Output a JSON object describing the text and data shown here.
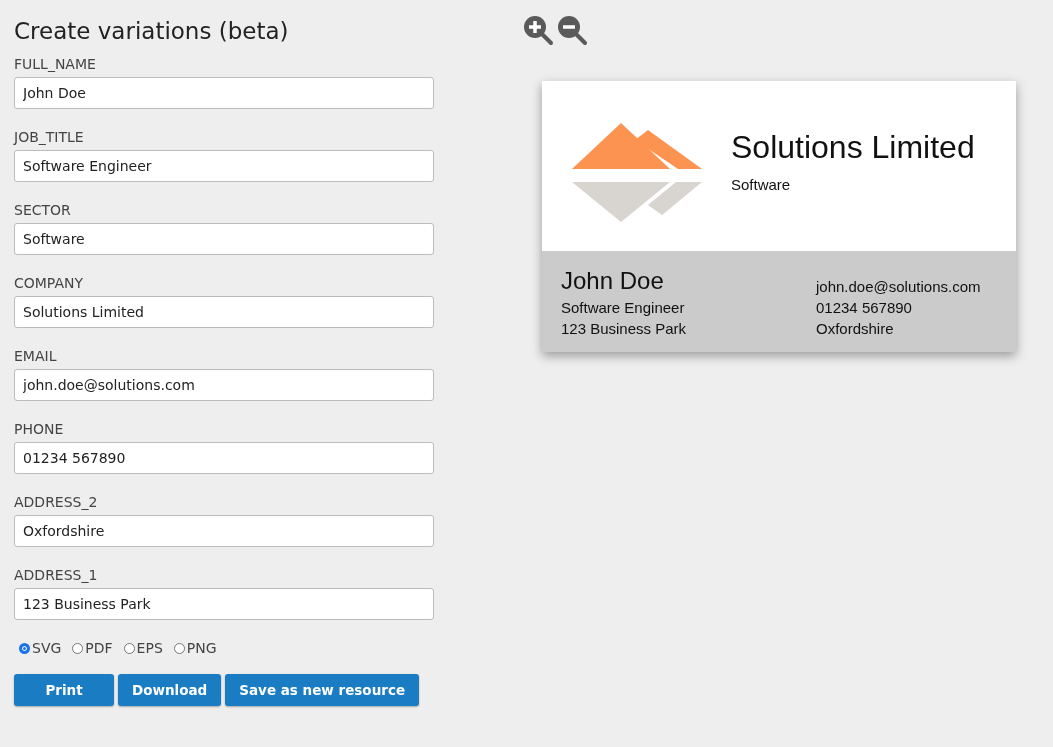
{
  "title": "Create variations (beta)",
  "fields": [
    {
      "label": "FULL_NAME",
      "value": "John Doe"
    },
    {
      "label": "JOB_TITLE",
      "value": "Software Engineer"
    },
    {
      "label": "SECTOR",
      "value": "Software"
    },
    {
      "label": "COMPANY",
      "value": "Solutions Limited"
    },
    {
      "label": "EMAIL",
      "value": "john.doe@solutions.com"
    },
    {
      "label": "PHONE",
      "value": "01234 567890"
    },
    {
      "label": "ADDRESS_2",
      "value": "Oxfordshire"
    },
    {
      "label": "ADDRESS_1",
      "value": "123 Business Park"
    }
  ],
  "formats": [
    {
      "label": "SVG",
      "selected": true
    },
    {
      "label": "PDF",
      "selected": false
    },
    {
      "label": "EPS",
      "selected": false
    },
    {
      "label": "PNG",
      "selected": false
    }
  ],
  "buttons": [
    "Print",
    "Download",
    "Save as new resource"
  ],
  "card": {
    "company": "Solutions Limited",
    "sector": "Software",
    "name": "John Doe",
    "job_title": "Software Engineer",
    "address_1": "123 Business Park",
    "email": "john.doe@solutions.com",
    "phone": "01234 567890",
    "address_2": "Oxfordshire"
  }
}
